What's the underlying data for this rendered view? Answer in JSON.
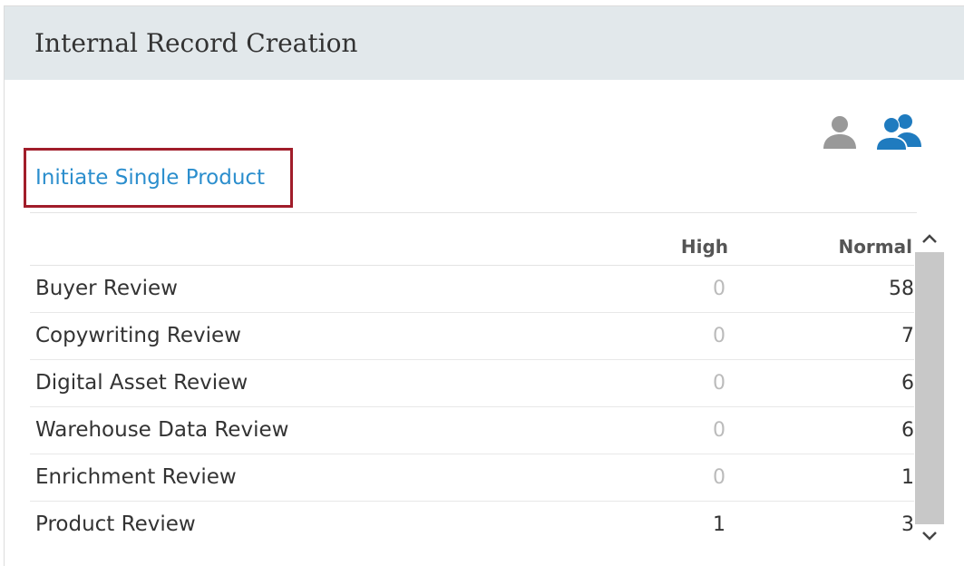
{
  "panel": {
    "title": "Internal Record Creation"
  },
  "view_toggle": {
    "single_icon": "person-icon",
    "group_icon": "people-icon",
    "active": "group",
    "active_color": "#1f7bbf",
    "inactive_color": "#999999"
  },
  "actions": {
    "initiate_label": "Initiate Single Product"
  },
  "table": {
    "columns": [
      "",
      "High",
      "Normal"
    ],
    "rows": [
      {
        "name": "Buyer Review",
        "high": "0",
        "normal": "58"
      },
      {
        "name": "Copywriting Review",
        "high": "0",
        "normal": "7"
      },
      {
        "name": "Digital Asset Review",
        "high": "0",
        "normal": "6"
      },
      {
        "name": "Warehouse Data Review",
        "high": "0",
        "normal": "6"
      },
      {
        "name": "Enrichment Review",
        "high": "0",
        "normal": "1"
      },
      {
        "name": "Product Review",
        "high": "1",
        "normal": "3"
      }
    ]
  },
  "colors": {
    "header_bg": "#e2e8eb",
    "link": "#2b8ecd",
    "highlight_border": "#a11d2a"
  }
}
